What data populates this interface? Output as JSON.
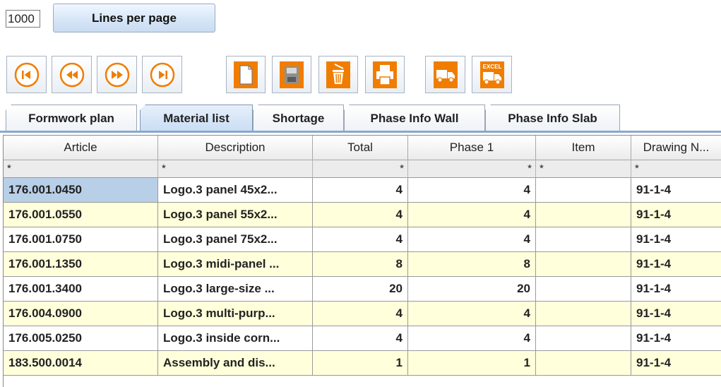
{
  "lines_per_page": {
    "value": "1000",
    "button_label": "Lines per page"
  },
  "toolbar": {
    "icons": [
      "first-page-icon",
      "previous-page-icon",
      "next-page-icon",
      "last-page-icon",
      "new-document-icon",
      "save-icon",
      "delete-icon",
      "print-icon",
      "delivery-truck-icon",
      "excel-export-icon"
    ],
    "excel_text": "EXCEL",
    "accent_color": "#f07d00"
  },
  "tabs": [
    {
      "label": "Formwork plan",
      "active": false
    },
    {
      "label": "Material list",
      "active": true
    },
    {
      "label": "Shortage",
      "active": false
    },
    {
      "label": "Phase Info Wall",
      "active": false
    },
    {
      "label": "Phase Info Slab",
      "active": false
    }
  ],
  "table": {
    "headers": [
      "Article",
      "Description",
      "Total",
      "Phase  1",
      "Item",
      "Drawing N..."
    ],
    "filters": [
      "*",
      "*",
      "*",
      "*",
      "*",
      "*"
    ],
    "rows": [
      [
        "176.001.0450",
        "Logo.3 panel 45x2...",
        "4",
        "4",
        "",
        "91-1-4"
      ],
      [
        "176.001.0550",
        "Logo.3 panel 55x2...",
        "4",
        "4",
        "",
        "91-1-4"
      ],
      [
        "176.001.0750",
        "Logo.3 panel 75x2...",
        "4",
        "4",
        "",
        "91-1-4"
      ],
      [
        "176.001.1350",
        "Logo.3 midi-panel ...",
        "8",
        "8",
        "",
        "91-1-4"
      ],
      [
        "176.001.3400",
        "Logo.3 large-size ...",
        "20",
        "20",
        "",
        "91-1-4"
      ],
      [
        "176.004.0900",
        "Logo.3 multi-purp...",
        "4",
        "4",
        "",
        "91-1-4"
      ],
      [
        "176.005.0250",
        "Logo.3 inside corn...",
        "4",
        "4",
        "",
        "91-1-4"
      ],
      [
        "183.500.0014",
        "Assembly and dis...",
        "1",
        "1",
        "",
        "91-1-4"
      ]
    ],
    "selected_row": 0
  }
}
